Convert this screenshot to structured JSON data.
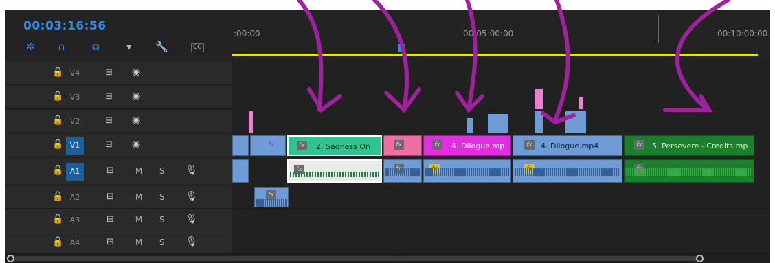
{
  "timecode": "00:03:16:56",
  "ruler": {
    "labels": [
      ":00:00",
      "00:05:00:00",
      "00:10:00:00"
    ]
  },
  "icons": [
    "ripple-icon",
    "snap-magnet-icon",
    "linked-selection-icon",
    "marker-icon",
    "wrench-icon",
    "captions-icon"
  ],
  "captions_label": "CC",
  "video_tracks": [
    {
      "name": "V4",
      "active": false
    },
    {
      "name": "V3",
      "active": false
    },
    {
      "name": "V2",
      "active": false
    },
    {
      "name": "V1",
      "active": true
    }
  ],
  "audio_tracks": [
    {
      "name": "A1",
      "active": true
    },
    {
      "name": "A2",
      "active": false
    },
    {
      "name": "A3",
      "active": false
    },
    {
      "name": "A4",
      "active": false
    }
  ],
  "mute_label": "M",
  "solo_label": "S",
  "fx_label": "fx",
  "clips": {
    "v1": [
      {
        "label": "",
        "color": "#6f9cd6"
      },
      {
        "label": "",
        "color": "#6f9cd6"
      },
      {
        "label": "2. Sadness On",
        "color": "#2ec48e"
      },
      {
        "label": "",
        "color": "#ee6fa3"
      },
      {
        "label": "4. Dilogue.mp",
        "color": "#df2fe0"
      },
      {
        "label": "4. Dilogue.mp4",
        "color": "#6f9cd6"
      },
      {
        "label": "5. Persevere - Credits.mp",
        "color": "#1a7e2c"
      }
    ]
  },
  "colors": {
    "accent": "#2d8ceb",
    "annotation": "#a020a0",
    "workarea": "#e8e400"
  }
}
